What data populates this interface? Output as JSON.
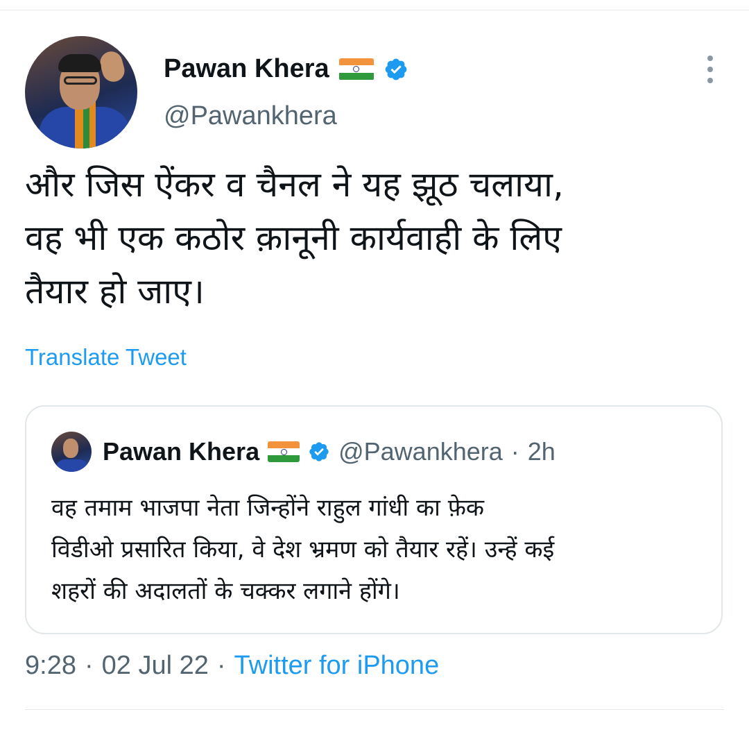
{
  "tweet": {
    "author": {
      "name": "Pawan Khera",
      "handle": "@Pawankhera",
      "flag_icon": "india-flag-icon",
      "verified_icon": "verified-badge-icon"
    },
    "more_icon": "more-options-icon",
    "text": "और जिस ऐंकर व चैनल ने यह झूठ चलाया,\nवह भी एक कठोर क़ानूनी कार्यवाही के लिए\nतैयार हो जाए।",
    "translate_label": "Translate Tweet",
    "time": "9:28",
    "date": "02 Jul 22",
    "separator": "·",
    "source": "Twitter for iPhone"
  },
  "quoted_tweet": {
    "author": {
      "name": "Pawan Khera",
      "handle": "@Pawankhera"
    },
    "separator": "·",
    "time": "2h",
    "text": "वह तमाम भाजपा नेता जिन्होंने राहुल गांधी का फ़ेक\nविडीओ प्रसारित किया, वे देश भ्रमण को तैयार रहें। उन्हें कई\nशहरों की अदालतों के चक्कर लगाने होंगे।"
  },
  "colors": {
    "accent": "#1d9bf0",
    "secondary_text": "#536471",
    "primary_text": "#0f1419",
    "border": "#e1e6e9"
  }
}
